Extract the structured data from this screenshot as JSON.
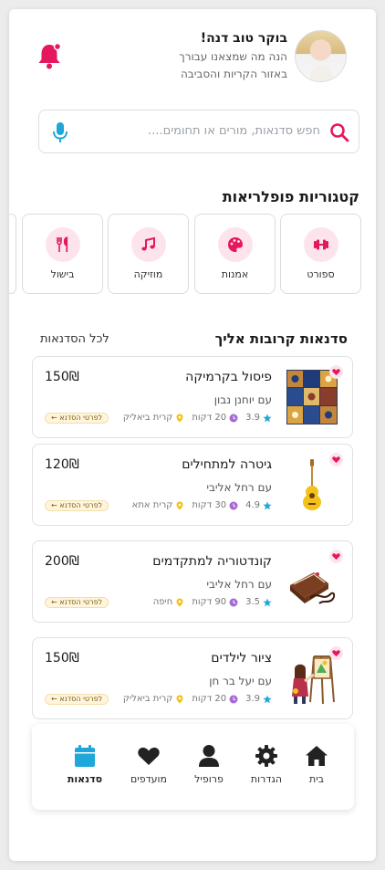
{
  "header": {
    "greeting": "בוקר טוב דנה!",
    "subtitle_line1": "הנה מה שמצאנו עבורך",
    "subtitle_line2": "באזור הקריות והסביבה",
    "avatar_icon": "user-photo",
    "bell_icon": "bell-icon",
    "accent_color": "#e5175e"
  },
  "search": {
    "placeholder": "חפש סדנאות, מורים או תחומים....",
    "search_icon": "search-icon",
    "mic_icon": "mic-icon"
  },
  "categories": {
    "title": "קטגוריות פופלריאות",
    "items": [
      {
        "label": "ספורט",
        "icon": "dumbbell-icon"
      },
      {
        "label": "אמנות",
        "icon": "palette-icon"
      },
      {
        "label": "מוזיקה",
        "icon": "music-icon"
      },
      {
        "label": "בישול",
        "icon": "utensils-icon"
      }
    ]
  },
  "workshops": {
    "title": "סדנאות קרובות אליך",
    "see_all": "לכל הסדנאות",
    "detail_label": "לפרטי הסדנא ←",
    "items": [
      {
        "name": "פיסול בקרמיקה",
        "teacher": "עם יוחנן נבון",
        "rating": "3.9",
        "duration": "20 דקות",
        "location": "קרית ביאליק",
        "price": "150₪",
        "thumb": "ceramic-tiles"
      },
      {
        "name": "גיטרה למתחילים",
        "teacher": "עם רחל אליבי",
        "rating": "4.9",
        "duration": "30 דקות",
        "location": "קרית אתא",
        "price": "120₪",
        "thumb": "guitar"
      },
      {
        "name": "קונדטוריה למתקדמים",
        "teacher": "עם רחל אליבי",
        "rating": "3.5",
        "duration": "90 דקות",
        "location": "חיפה",
        "price": "200₪",
        "thumb": "chocolate-cake"
      },
      {
        "name": "ציור לילדים",
        "teacher": "עם יעל בר חן",
        "rating": "3.9",
        "duration": "20 דקות",
        "location": "קרית ביאליק",
        "price": "150₪",
        "thumb": "child-painting"
      }
    ]
  },
  "nav": {
    "items": [
      {
        "label": "בית",
        "icon": "home-icon"
      },
      {
        "label": "הגדרות",
        "icon": "gear-icon"
      },
      {
        "label": "פרופיל",
        "icon": "user-icon"
      },
      {
        "label": "מועדפים",
        "icon": "heart-icon"
      },
      {
        "label": "סדנאות",
        "icon": "calendar-icon",
        "active": true
      }
    ],
    "active_color": "#1ea7d8"
  }
}
